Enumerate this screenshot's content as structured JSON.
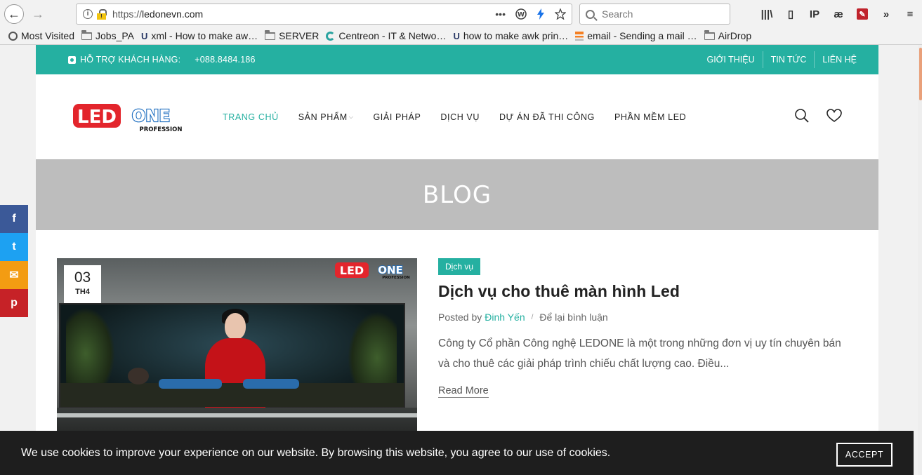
{
  "browser": {
    "url_prefix": "https://",
    "url_host": "ledonevn.com",
    "search_placeholder": "Search",
    "url_more": "•••",
    "bookmarks": [
      {
        "label": "Most Visited",
        "icon": "gear-icon"
      },
      {
        "label": "Jobs_PA",
        "icon": "folder-icon"
      },
      {
        "label": "xml - How to make aw…",
        "icon": "unix-icon"
      },
      {
        "label": "SERVER",
        "icon": "folder-icon"
      },
      {
        "label": "Centreon - IT & Netwo…",
        "icon": "centreon-icon"
      },
      {
        "label": "how to make awk prin…",
        "icon": "unix-icon"
      },
      {
        "label": "email - Sending a mail …",
        "icon": "stackoverflow-icon"
      },
      {
        "label": "AirDrop",
        "icon": "folder-icon"
      }
    ],
    "toolbar_glyphs": {
      "library": "|||\\",
      "reader": "▯",
      "ip": "IP",
      "ae": "æ",
      "overflow": "»",
      "menu": "≡"
    }
  },
  "topbar": {
    "support_label": "HỖ TRỢ KHÁCH HÀNG:",
    "phone": "+088.8484.186",
    "links": [
      "GIỚI THIỆU",
      "TIN TỨC",
      "LIÊN HỆ"
    ]
  },
  "nav": {
    "items": [
      "TRANG CHỦ",
      "SẢN PHẨM",
      "GIẢI PHÁP",
      "DỊCH VỤ",
      "DỰ ÁN ĐÃ THI CÔNG",
      "PHẦN MỀM LED"
    ],
    "active_index": 0
  },
  "logo": {
    "text_led": "LED",
    "text_one": "ONE",
    "tagline": "PROFESSION"
  },
  "banner": {
    "title": "BLOG"
  },
  "post": {
    "date_day": "03",
    "date_month": "TH4",
    "category": "Dịch vụ",
    "title": "Dịch vụ cho thuê màn hình Led",
    "posted_by": "Posted by",
    "author": "Đinh Yến",
    "meta_sep": "/",
    "comment_link": "Để lại bình luận",
    "excerpt": "Công ty Cổ phần Công nghệ LEDONE là một trong những đơn vị uy tín chuyên bán và cho thuê các giải pháp trình chiếu chất lượng cao. Điều...",
    "read_more": "Read More"
  },
  "social": {
    "facebook": "f",
    "twitter": "t",
    "email": "✉",
    "pinterest": "p"
  },
  "cookie": {
    "message": "We use cookies to improve your experience on our website. By browsing this website, you agree to our use of cookies.",
    "accept_label": "ACCEPT"
  },
  "colors": {
    "accent": "#25b0a1",
    "banner": "#bdbdbd",
    "cookie_bg": "#1e1e1e",
    "logo_red": "#e3252c",
    "logo_blue": "#1f6fc1"
  }
}
